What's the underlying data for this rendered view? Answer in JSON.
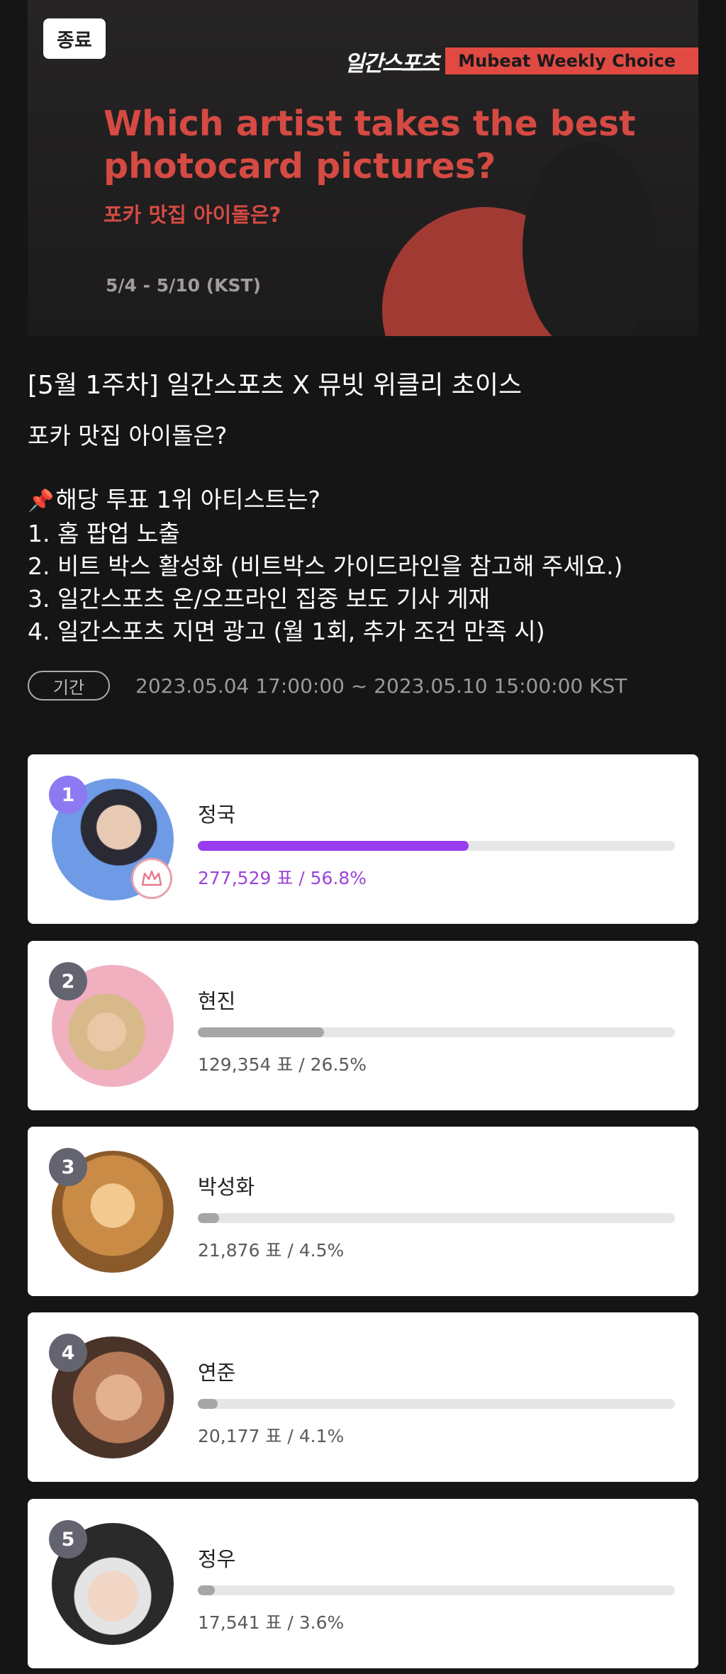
{
  "banner": {
    "status": "종료",
    "brand_logo": "일간스포츠",
    "brand_tag": "Mubeat Weekly Choice",
    "title": "Which artist takes the best photocard pictures?",
    "subtitle": "포카 맛집 아이돌은?",
    "dates": "5/4 - 5/10 (KST)"
  },
  "post": {
    "title": "[5월 1주차] 일간스포츠 X 뮤빗 위클리 초이스",
    "question": "포카 맛집 아이돌은?",
    "benefits_heading": "해당 투표 1위 아티스트는?",
    "benefits": [
      "1. 홈 팝업 노출",
      "2. 비트 박스 활성화 (비트박스 가이드라인을 참고해 주세요.)",
      "3. 일간스포츠 온/오프라인 집중 보도 기사 게재",
      "4. 일간스포츠 지면 광고 (월 1회, 추가 조건 만족 시)"
    ]
  },
  "period": {
    "label": "기간",
    "value": "2023.05.04 17:00:00 ~ 2023.05.10 15:00:00 KST"
  },
  "results": [
    {
      "rank": "1",
      "name": "정국",
      "votes": "277,529 표 / 56.8%",
      "percent": 56.8
    },
    {
      "rank": "2",
      "name": "현진",
      "votes": "129,354 표 / 26.5%",
      "percent": 26.5
    },
    {
      "rank": "3",
      "name": "박성화",
      "votes": "21,876 표 / 4.5%",
      "percent": 4.5
    },
    {
      "rank": "4",
      "name": "연준",
      "votes": "20,177 표 / 4.1%",
      "percent": 4.1
    },
    {
      "rank": "5",
      "name": "정우",
      "votes": "17,541 표 / 3.6%",
      "percent": 3.6
    }
  ],
  "colors": {
    "accent": "#d54a43",
    "winner_bar": "#9a3cf0",
    "bar": "#a6a6a6"
  }
}
